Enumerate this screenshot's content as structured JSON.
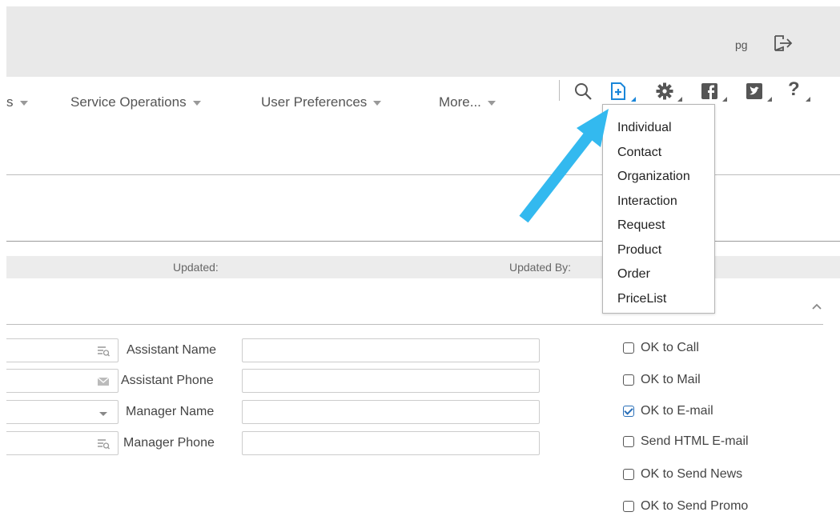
{
  "header": {
    "user_initials": "pg"
  },
  "nav": {
    "items": [
      {
        "label": "s"
      },
      {
        "label": "Service Operations"
      },
      {
        "label": "User Preferences"
      },
      {
        "label": "More..."
      }
    ]
  },
  "toolbar": {
    "icons": [
      "search-icon",
      "new-record-icon",
      "gear-icon",
      "facebook-icon",
      "twitter-icon",
      "help-icon"
    ],
    "help_label": "?"
  },
  "new_menu": {
    "items": [
      {
        "label": "Individual"
      },
      {
        "label": "Contact"
      },
      {
        "label": "Organization"
      },
      {
        "label": "Interaction"
      },
      {
        "label": "Request"
      },
      {
        "label": "Product"
      },
      {
        "label": "Order"
      },
      {
        "label": "PriceList"
      }
    ]
  },
  "info": {
    "updated_label": "Updated:",
    "updated_by_label": "Updated By:"
  },
  "form": {
    "assistant_name_label": "Assistant Name",
    "assistant_name_value": "",
    "assistant_phone_label": "Assistant Phone",
    "assistant_phone_value": "",
    "manager_name_label": "Manager Name",
    "manager_name_value": "",
    "manager_phone_label": "Manager Phone",
    "manager_phone_value": ""
  },
  "preferences": [
    {
      "label": "OK to Call",
      "checked": false
    },
    {
      "label": "OK to Mail",
      "checked": false
    },
    {
      "label": "OK to E-mail",
      "checked": true
    },
    {
      "label": "Send HTML E-mail",
      "checked": false
    },
    {
      "label": "OK to Send News",
      "checked": false
    },
    {
      "label": "OK to Send Promo",
      "checked": false
    }
  ],
  "colors": {
    "accent": "#2a6fb8",
    "arrow": "#33b9ef",
    "topbar": "#e9e9e9"
  }
}
